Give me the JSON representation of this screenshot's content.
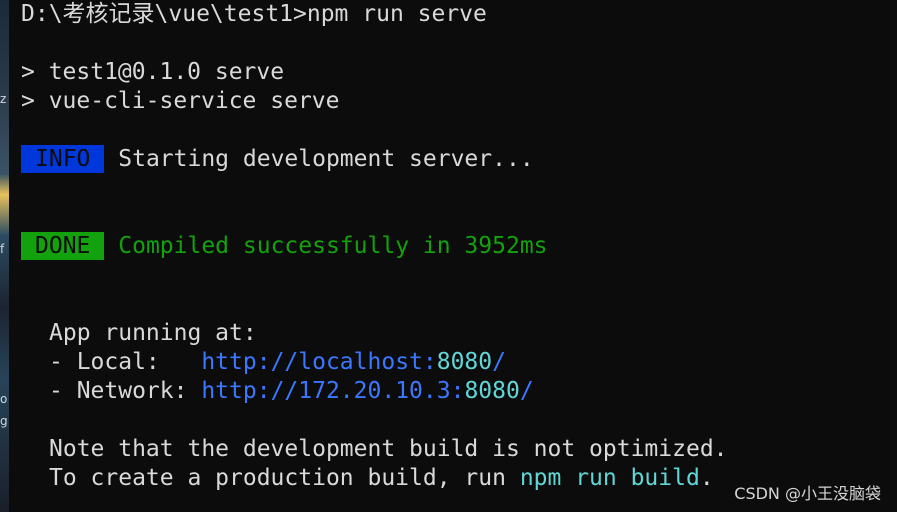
{
  "terminal": {
    "prompt_line": "D:\\考核记录\\vue\\test1>npm run serve",
    "script_line_1": "> test1@0.1.0 serve",
    "script_line_2": "> vue-cli-service serve",
    "info": {
      "tag": "INFO",
      "message": "Starting development server..."
    },
    "done": {
      "tag": "DONE",
      "message": "Compiled successfully in 3952ms"
    },
    "app_running": "App running at:",
    "local": {
      "label": "- Local:   ",
      "url": "http://localhost:",
      "port": "8080",
      "suffix": "/"
    },
    "network": {
      "label": "- Network: ",
      "url": "http://172.20.10.3:",
      "port": "8080",
      "suffix": "/"
    },
    "note_line": "Note that the development build is not optimized.",
    "build_line_prefix": "To create a production build, run ",
    "build_command": "npm run build",
    "build_line_suffix": "."
  },
  "left_strip": {
    "glyph_1": "z",
    "glyph_2": "f",
    "glyph_3": "o",
    "glyph_4": "g"
  },
  "watermark": "CSDN @小王没脑袋",
  "colors": {
    "background": "#0c0c0c",
    "text": "#d9d9d9",
    "info_badge": "#0037da",
    "done_badge": "#13a10e",
    "success_text": "#13a10e",
    "link": "#3b78ff",
    "port": "#61d6d6"
  }
}
